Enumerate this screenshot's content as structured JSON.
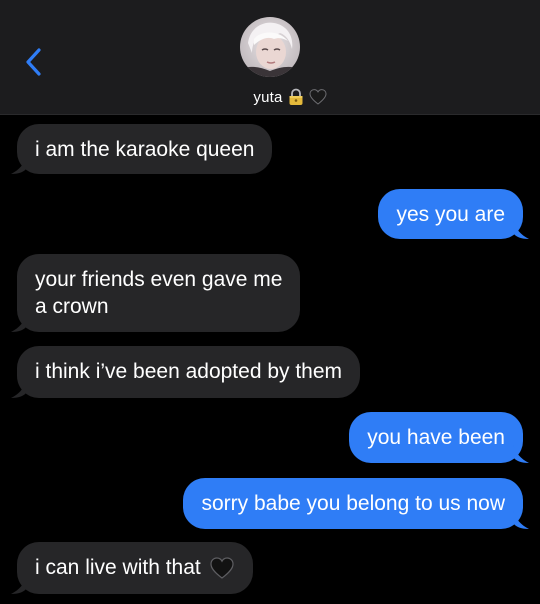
{
  "header": {
    "contact_name": "yuta",
    "name_emojis": [
      "lock-icon",
      "black-heart-icon"
    ]
  },
  "messages": [
    {
      "direction": "received",
      "text": "i am the karaoke queen"
    },
    {
      "direction": "sent",
      "text": "yes you are"
    },
    {
      "direction": "received",
      "lines": [
        "your friends even gave me",
        "a crown"
      ]
    },
    {
      "direction": "received",
      "text": "i think i’ve been adopted by them"
    },
    {
      "direction": "sent",
      "text": "you have been"
    },
    {
      "direction": "sent",
      "text": "sorry babe you belong to us now"
    },
    {
      "direction": "received",
      "text": "i can live with that",
      "emoji": "black-heart-icon"
    }
  ],
  "colors": {
    "background": "#000000",
    "header_background": "#1c1c1e",
    "received_bubble": "#262628",
    "sent_bubble": "#2f7df6",
    "back_chevron": "#2f7df6"
  }
}
